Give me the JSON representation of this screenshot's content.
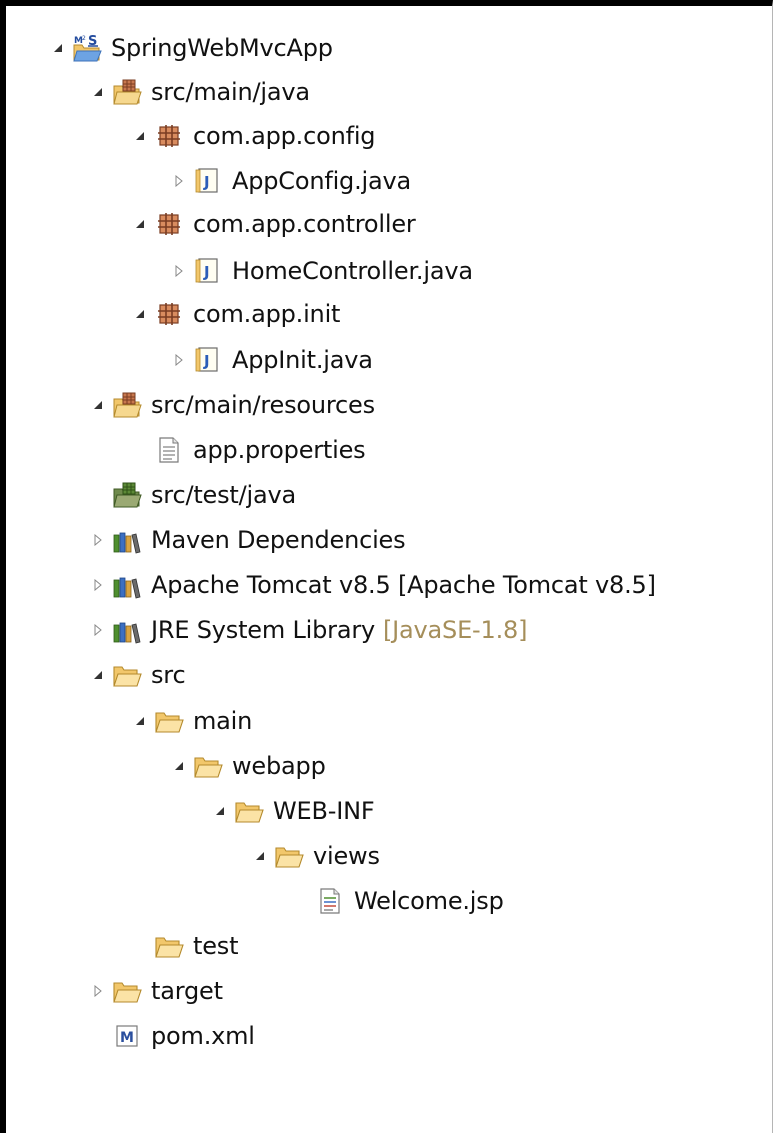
{
  "project": {
    "name": "SpringWebMvcApp"
  },
  "tree": [
    {
      "id": "project",
      "label": "SpringWebMvcApp",
      "icon": "maven-project-icon",
      "state": "expanded"
    },
    {
      "id": "src-main-java",
      "label": "src/main/java",
      "icon": "source-folder-icon",
      "state": "expanded"
    },
    {
      "id": "pkg-config",
      "label": "com.app.config",
      "icon": "package-icon",
      "state": "expanded"
    },
    {
      "id": "file-appconfig",
      "label": "AppConfig.java",
      "icon": "java-file-icon",
      "state": "collapsed"
    },
    {
      "id": "pkg-controller",
      "label": "com.app.controller",
      "icon": "package-icon",
      "state": "expanded"
    },
    {
      "id": "file-homecontroller",
      "label": "HomeController.java",
      "icon": "java-file-icon",
      "state": "collapsed"
    },
    {
      "id": "pkg-init",
      "label": "com.app.init",
      "icon": "package-icon",
      "state": "expanded"
    },
    {
      "id": "file-appinit",
      "label": "AppInit.java",
      "icon": "java-file-icon",
      "state": "collapsed"
    },
    {
      "id": "src-main-resources",
      "label": "src/main/resources",
      "icon": "source-folder-icon",
      "state": "expanded"
    },
    {
      "id": "file-app-properties",
      "label": "app.properties",
      "icon": "text-file-icon",
      "state": "leaf"
    },
    {
      "id": "src-test-java",
      "label": "src/test/java",
      "icon": "empty-source-folder-icon",
      "state": "leaf"
    },
    {
      "id": "maven-dependencies",
      "label": "Maven Dependencies",
      "icon": "library-icon",
      "state": "collapsed"
    },
    {
      "id": "apache-tomcat",
      "label": "Apache Tomcat v8.5 [Apache Tomcat v8.5]",
      "icon": "library-icon",
      "state": "collapsed"
    },
    {
      "id": "jre-system-library",
      "label": "JRE System Library",
      "decoration": "[JavaSE-1.8]",
      "icon": "library-icon",
      "state": "collapsed"
    },
    {
      "id": "folder-src",
      "label": "src",
      "icon": "folder-icon",
      "state": "expanded"
    },
    {
      "id": "folder-main",
      "label": "main",
      "icon": "folder-icon",
      "state": "expanded"
    },
    {
      "id": "folder-webapp",
      "label": "webapp",
      "icon": "folder-icon",
      "state": "expanded"
    },
    {
      "id": "folder-web-inf",
      "label": "WEB-INF",
      "icon": "folder-icon",
      "state": "expanded"
    },
    {
      "id": "folder-views",
      "label": "views",
      "icon": "folder-icon",
      "state": "expanded"
    },
    {
      "id": "file-welcome-jsp",
      "label": "Welcome.jsp",
      "icon": "jsp-file-icon",
      "state": "leaf"
    },
    {
      "id": "folder-test",
      "label": "test",
      "icon": "folder-icon",
      "state": "leaf"
    },
    {
      "id": "folder-target",
      "label": "target",
      "icon": "folder-icon",
      "state": "collapsed"
    },
    {
      "id": "file-pom",
      "label": "pom.xml",
      "icon": "maven-pom-icon",
      "state": "leaf"
    }
  ],
  "colors": {
    "text": "#111111",
    "decoration": "#a58e5a",
    "folder": "#f2c76b",
    "package": "#9a5a3c",
    "java_blue": "#2b5db8",
    "library_green": "#4f8f2f"
  }
}
